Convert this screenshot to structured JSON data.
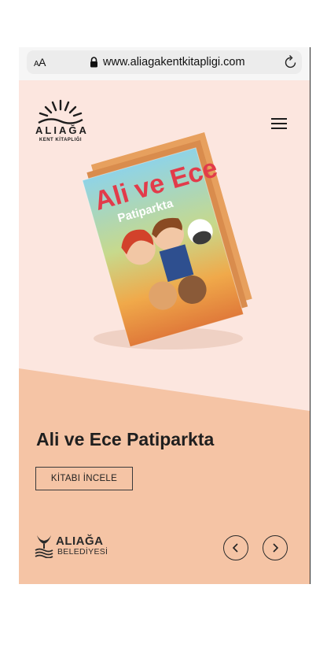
{
  "browser": {
    "text_size_label_small": "A",
    "text_size_label_large": "A",
    "url": "www.aliagakentkitapligi.com"
  },
  "header": {
    "logo_name": "ALIAĞA",
    "logo_subtitle": "KENT KİTAPLIĞI",
    "menu_icon": "hamburger-icon"
  },
  "hero": {
    "book_cover_title": "Ali ve Ece",
    "book_cover_subtitle": "Patiparkta",
    "title": "Ali ve Ece Patiparkta",
    "button_label": "KİTABI İNCELE"
  },
  "footer": {
    "logo_name": "ALIAĞA",
    "logo_subtitle": "BELEDİYESİ",
    "prev_icon": "chevron-left-icon",
    "next_icon": "chevron-right-icon"
  },
  "colors": {
    "top_bg": "#fce6df",
    "bottom_bg": "#f5c4a5",
    "text": "#1f1f1f"
  }
}
